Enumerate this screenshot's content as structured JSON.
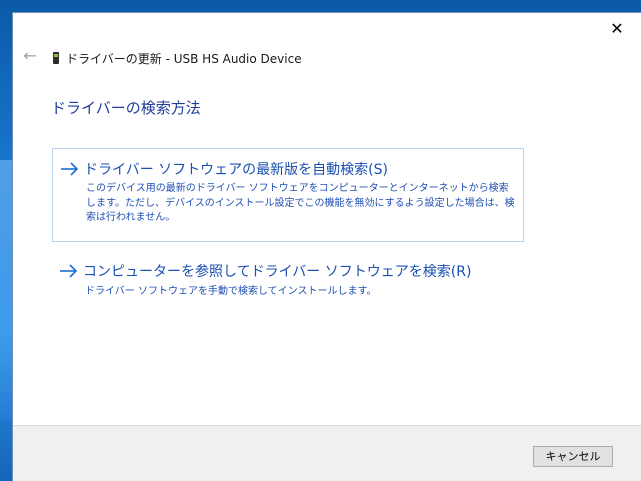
{
  "window": {
    "title": "ドライバーの更新 - USB HS Audio Device",
    "close_glyph": "✕",
    "back_glyph": "←"
  },
  "page": {
    "heading": "ドライバーの検索方法"
  },
  "options": [
    {
      "title": "ドライバー ソフトウェアの最新版を自動検索(S)",
      "description": "このデバイス用の最新のドライバー ソフトウェアをコンピューターとインターネットから検索します。ただし、デバイスのインストール設定でこの機能を無効にするよう設定した場合は、検索は行われません。"
    },
    {
      "title": "コンピューターを参照してドライバー ソフトウェアを検索(R)",
      "description": "ドライバー ソフトウェアを手動で検索してインストールします。"
    }
  ],
  "footer": {
    "cancel_label": "キャンセル"
  },
  "colors": {
    "link_blue": "#1b4fb0",
    "heading_blue": "#1f3d99",
    "option_border": "#b9d3ea",
    "footer_bg": "#f0f0f0"
  },
  "icons": {
    "back": "back-arrow-icon",
    "close": "close-icon",
    "device": "usb-device-icon",
    "option_arrow": "arrow-right-icon"
  }
}
